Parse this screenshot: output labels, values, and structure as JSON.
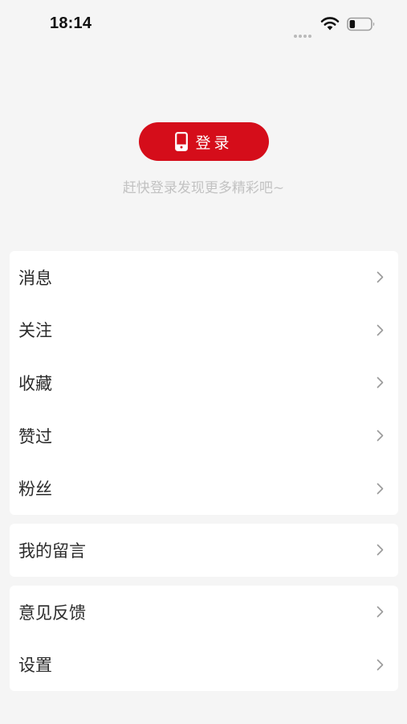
{
  "status_bar": {
    "time": "18:14",
    "icons": [
      "signal-dots-icon",
      "wifi-icon",
      "battery-icon"
    ]
  },
  "login": {
    "button_label": "登录",
    "button_icon": "phone-icon",
    "hint": "赶快登录发现更多精彩吧~"
  },
  "colors": {
    "accent": "#d50d1a",
    "background": "#f5f5f5",
    "hint_text": "#c2c2c2",
    "chevron": "#9a9a9a"
  },
  "menu_groups": [
    {
      "items": [
        {
          "label": "消息"
        },
        {
          "label": "关注"
        },
        {
          "label": "收藏"
        },
        {
          "label": "赞过"
        },
        {
          "label": "粉丝"
        }
      ]
    },
    {
      "items": [
        {
          "label": "我的留言"
        }
      ]
    },
    {
      "items": [
        {
          "label": "意见反馈"
        },
        {
          "label": "设置"
        }
      ]
    }
  ]
}
